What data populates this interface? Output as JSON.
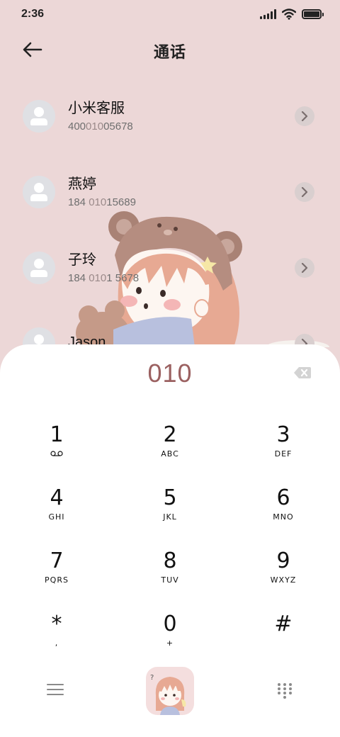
{
  "status": {
    "time": "2:36"
  },
  "header": {
    "title": "通话"
  },
  "contacts": [
    {
      "name": "小米客服",
      "number_pre": "400",
      "number_match": "010",
      "number_post": "05678"
    },
    {
      "name": "燕婷",
      "number_pre": "184 ",
      "number_match": "010",
      "number_post": "15689"
    },
    {
      "name": "子玲",
      "number_pre": "184 ",
      "number_match": "010",
      "number_post": "1 5678"
    },
    {
      "name": "Jason",
      "number_pre": "",
      "number_match": "",
      "number_post": ""
    }
  ],
  "dialer": {
    "number": "010",
    "keys": [
      {
        "digit": "1",
        "letters": ""
      },
      {
        "digit": "2",
        "letters": "ABC"
      },
      {
        "digit": "3",
        "letters": "DEF"
      },
      {
        "digit": "4",
        "letters": "GHI"
      },
      {
        "digit": "5",
        "letters": "JKL"
      },
      {
        "digit": "6",
        "letters": "MNO"
      },
      {
        "digit": "7",
        "letters": "PQRS"
      },
      {
        "digit": "8",
        "letters": "TUV"
      },
      {
        "digit": "9",
        "letters": "WXYZ"
      },
      {
        "digit": "*",
        "letters": ","
      },
      {
        "digit": "0",
        "letters": "+"
      },
      {
        "digit": "#",
        "letters": ""
      }
    ]
  },
  "icons": {
    "back": "arrow-left-icon",
    "detail": "chevron-right-icon",
    "backspace": "backspace-icon",
    "voicemail": "voicemail-icon",
    "menu": "menu-icon",
    "keypad": "dialpad-icon",
    "call": "call-button-illustration"
  },
  "colors": {
    "background": "#ecd7d7",
    "dialed_number": "#9b6161",
    "avatar": "#dfe0e4"
  }
}
